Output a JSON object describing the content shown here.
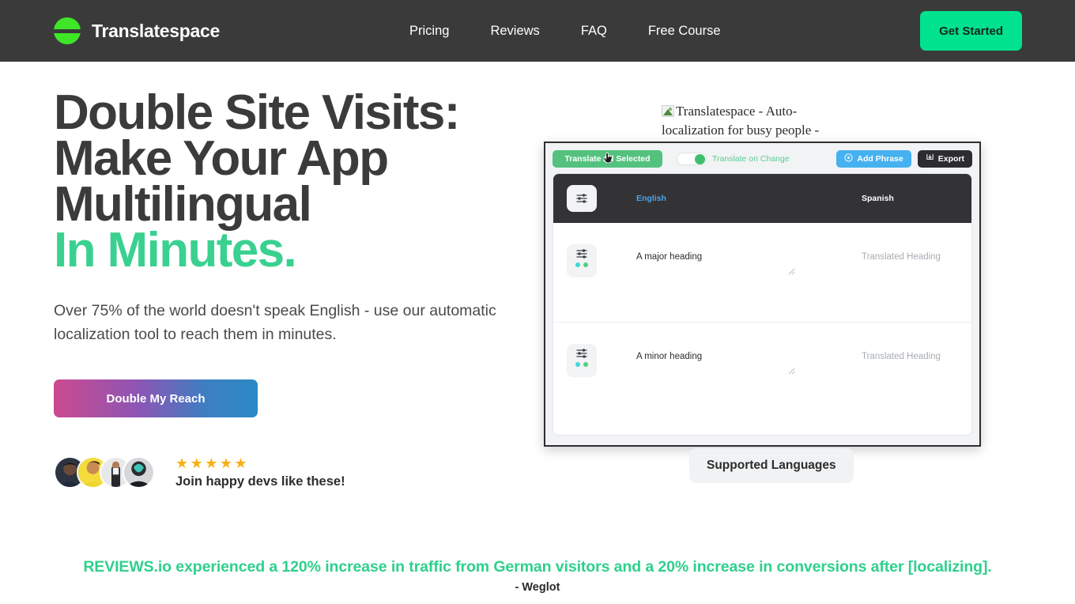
{
  "header": {
    "brand": "Translatespace",
    "logo_icon": "sphere-logo-icon",
    "nav": [
      {
        "label": "Pricing"
      },
      {
        "label": "Reviews"
      },
      {
        "label": "FAQ"
      },
      {
        "label": "Free Course"
      }
    ],
    "cta_label": "Get Started",
    "background_color": "#3a3a3a",
    "cta_color": "#00e28d"
  },
  "hero": {
    "title_line1": "Double Site Visits:",
    "title_line2": "Make Your App",
    "title_line3": "Multilingual",
    "title_accent": "In Minutes.",
    "accent_color": "#3ad190",
    "subtitle": "Over 75% of the world doesn't speak English - use our automatic localization tool to reach them in minutes.",
    "cta_label": "Double My Reach",
    "cta_gradient_from": "#cc4a8f",
    "cta_gradient_to": "#2a8ac6",
    "social_proof": {
      "stars": "★★★★★",
      "star_count": 5,
      "star_color": "#f5b017",
      "caption": "Join happy devs like these!",
      "avatars": [
        {
          "name": "avatar-1"
        },
        {
          "name": "avatar-2"
        },
        {
          "name": "avatar-3"
        },
        {
          "name": "avatar-4"
        }
      ]
    }
  },
  "product_image": {
    "alt_text": "Translatespace - Auto-localization for busy people -",
    "broken_icon": "broken-image-icon"
  },
  "app_mock": {
    "toolbar": {
      "translate_all_label": "Translate All Selected",
      "translate_on_change_label": "Translate on Change",
      "translate_on_change_value": "on",
      "add_phrase_label": "Add Phrase",
      "export_label": "Export",
      "translate_all_color": "#54c27e",
      "add_phrase_color": "#46b1f0",
      "export_color": "#2d2d31"
    },
    "columns": {
      "source_language": "English",
      "target_language": "Spanish",
      "source_color": "#4da3e8",
      "target_color": "#ffffff"
    },
    "rows": [
      {
        "source": "A major heading",
        "target_placeholder": "Translated Heading",
        "icon": "sliders-icon",
        "dot_1_color": "#3ed8d8",
        "dot_2_color": "#4ed07f"
      },
      {
        "source": "A minor heading",
        "target_placeholder": "Translated Heading",
        "icon": "sliders-icon",
        "dot_1_color": "#3ed8d8",
        "dot_2_color": "#4ed07f"
      }
    ]
  },
  "supported_languages": {
    "label": "Supported Languages"
  },
  "testimonial": {
    "quote": "REVIEWS.io experienced a 120% increase in traffic from German visitors and a 20% increase in conversions after [localizing].",
    "author": "- Weglot",
    "quote_color": "#2ed08c"
  }
}
